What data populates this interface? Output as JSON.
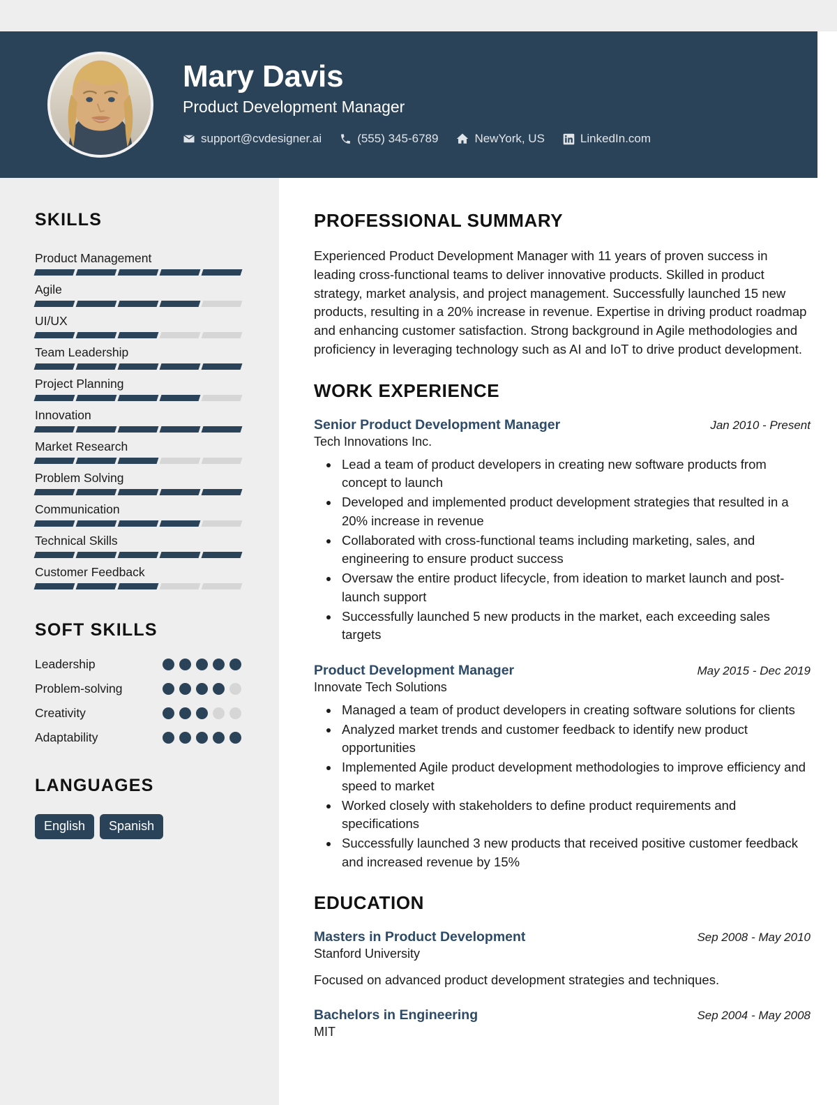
{
  "theme": {
    "primary": "#2b4359",
    "accent_title": "#2d4a68",
    "sidebar_bg": "#eeeeee",
    "bar_off": "#d6d6d6",
    "page_bg": "#ffffff"
  },
  "header": {
    "name": "Mary Davis",
    "job_title": "Product Development Manager",
    "contacts": [
      {
        "icon": "email-icon",
        "text": "support@cvdesigner.ai"
      },
      {
        "icon": "phone-icon",
        "text": "(555) 345-6789"
      },
      {
        "icon": "home-icon",
        "text": "NewYork, US"
      },
      {
        "icon": "linkedin-icon",
        "text": "LinkedIn.com"
      }
    ]
  },
  "sidebar": {
    "skills_heading": "SKILLS",
    "skills": [
      {
        "name": "Product Management",
        "level": 5,
        "max": 5
      },
      {
        "name": "Agile",
        "level": 4,
        "max": 5
      },
      {
        "name": "UI/UX",
        "level": 3,
        "max": 5
      },
      {
        "name": "Team Leadership",
        "level": 5,
        "max": 5
      },
      {
        "name": "Project Planning",
        "level": 4,
        "max": 5
      },
      {
        "name": "Innovation",
        "level": 5,
        "max": 5
      },
      {
        "name": "Market Research",
        "level": 3,
        "max": 5
      },
      {
        "name": "Problem Solving",
        "level": 5,
        "max": 5
      },
      {
        "name": "Communication",
        "level": 4,
        "max": 5
      },
      {
        "name": "Technical Skills",
        "level": 5,
        "max": 5
      },
      {
        "name": "Customer Feedback",
        "level": 3,
        "max": 5
      }
    ],
    "soft_skills_heading": "SOFT SKILLS",
    "soft_skills": [
      {
        "name": "Leadership",
        "level": 5,
        "max": 5
      },
      {
        "name": "Problem-solving",
        "level": 4,
        "max": 5
      },
      {
        "name": "Creativity",
        "level": 3,
        "max": 5
      },
      {
        "name": "Adaptability",
        "level": 5,
        "max": 5
      }
    ],
    "languages_heading": "LANGUAGES",
    "languages": [
      "English",
      "Spanish"
    ]
  },
  "main": {
    "summary_heading": "PROFESSIONAL SUMMARY",
    "summary_text": "Experienced Product Development Manager with 11 years of proven success in leading cross-functional teams to deliver innovative products. Skilled in product strategy, market analysis, and project management. Successfully launched 15 new products, resulting in a 20% increase in revenue. Expertise in driving product roadmap and enhancing customer satisfaction. Strong background in Agile methodologies and proficiency in leveraging technology such as AI and IoT to drive product development.",
    "work_heading": "WORK EXPERIENCE",
    "work": [
      {
        "title": "Senior Product Development Manager",
        "date": "Jan 2010 - Present",
        "org": "Tech Innovations Inc.",
        "bullets": [
          "Lead a team of product developers in creating new software products from concept to launch",
          "Developed and implemented product development strategies that resulted in a 20% increase in revenue",
          "Collaborated with cross-functional teams including marketing, sales, and engineering to ensure product success",
          "Oversaw the entire product lifecycle, from ideation to market launch and post-launch support",
          "Successfully launched 5 new products in the market, each exceeding sales targets"
        ]
      },
      {
        "title": "Product Development Manager",
        "date": "May 2015 - Dec 2019",
        "org": "Innovate Tech Solutions",
        "bullets": [
          "Managed a team of product developers in creating software solutions for clients",
          "Analyzed market trends and customer feedback to identify new product opportunities",
          "Implemented Agile product development methodologies to improve efficiency and speed to market",
          "Worked closely with stakeholders to define product requirements and specifications",
          "Successfully launched 3 new products that received positive customer feedback and increased revenue by 15%"
        ]
      }
    ],
    "education_heading": "EDUCATION",
    "education": [
      {
        "degree": "Masters in Product Development",
        "date": "Sep 2008 - May 2010",
        "school": "Stanford University",
        "description": "Focused on advanced product development strategies and techniques."
      },
      {
        "degree": "Bachelors in Engineering",
        "date": "Sep 2004 - May 2008",
        "school": "MIT",
        "description": ""
      }
    ]
  }
}
